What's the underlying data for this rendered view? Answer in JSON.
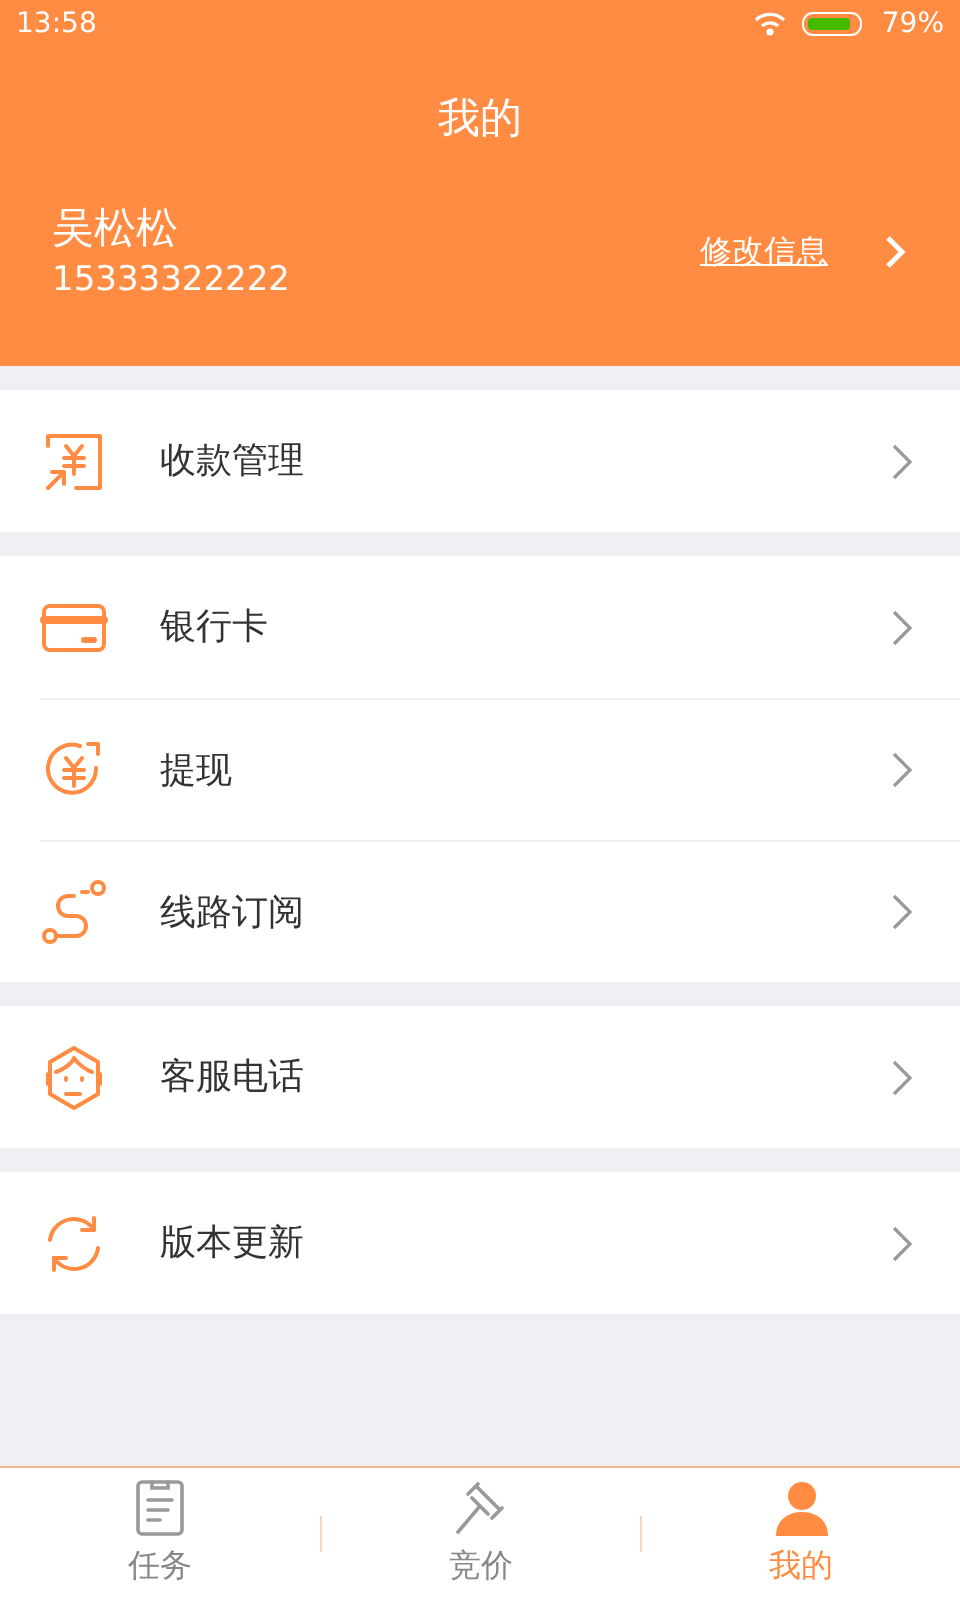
{
  "status_bar": {
    "time": "13:58",
    "battery": "79%"
  },
  "header": {
    "title": "我的",
    "name": "吴松松",
    "phone": "15333322222",
    "edit_link": "修改信息"
  },
  "groups": [
    {
      "items": [
        {
          "kind": "payment",
          "label": "收款管理"
        }
      ]
    },
    {
      "items": [
        {
          "kind": "card",
          "label": "银行卡"
        },
        {
          "kind": "withdraw",
          "label": "提现"
        },
        {
          "kind": "route",
          "label": "线路订阅"
        }
      ]
    },
    {
      "items": [
        {
          "kind": "service",
          "label": "客服电话"
        }
      ]
    },
    {
      "items": [
        {
          "kind": "update",
          "label": "版本更新"
        }
      ]
    }
  ],
  "tabs": [
    {
      "kind": "task",
      "label": "任务",
      "selected": false
    },
    {
      "kind": "bid",
      "label": "竞价",
      "selected": false
    },
    {
      "kind": "me",
      "label": "我的",
      "selected": true
    }
  ]
}
